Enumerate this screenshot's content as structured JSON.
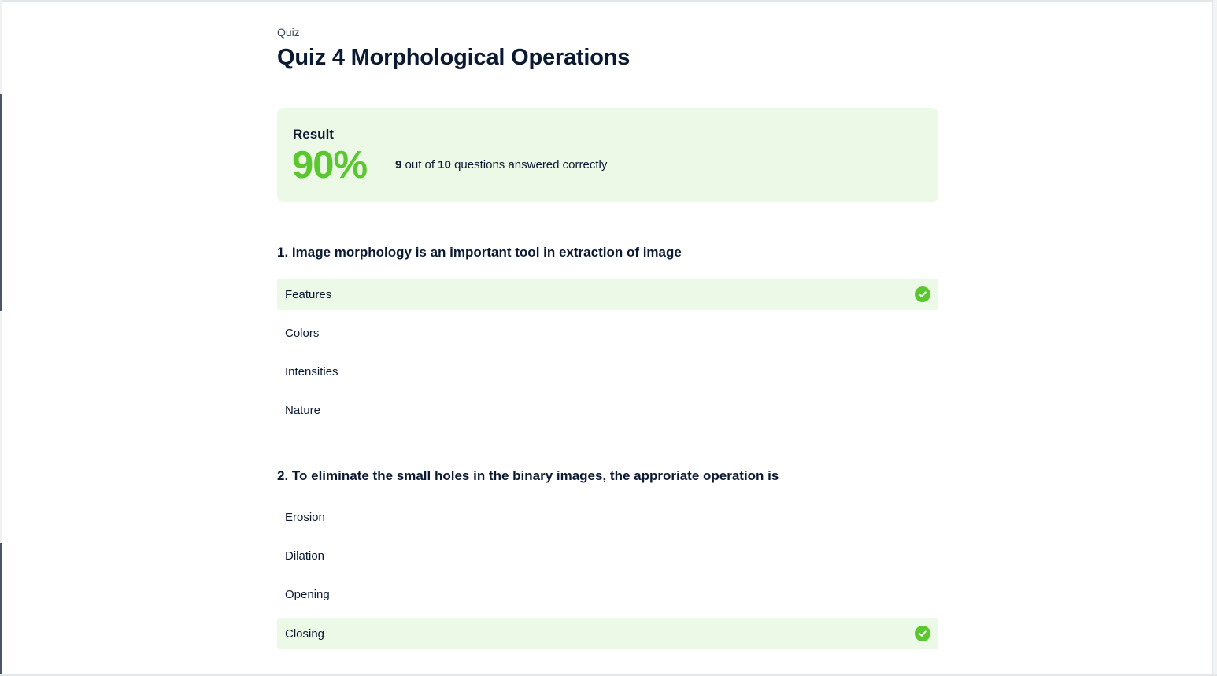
{
  "breadcrumb": "Quiz",
  "title": "Quiz 4 Morphological Operations",
  "result": {
    "label": "Result",
    "score": "90%",
    "correct_count": "9",
    "out_of_text": "out of",
    "total_count": "10",
    "suffix_text": "questions answered correctly"
  },
  "colors": {
    "accent_green": "#5ac731",
    "correct_bg": "#edf9e7",
    "text_dark": "#0b1a33"
  },
  "questions": [
    {
      "text": "1. Image morphology is an important tool in extraction of image",
      "options": [
        {
          "label": "Features",
          "correct": true,
          "icon": "check-circle-icon"
        },
        {
          "label": "Colors",
          "correct": false
        },
        {
          "label": "Intensities",
          "correct": false
        },
        {
          "label": "Nature",
          "correct": false
        }
      ]
    },
    {
      "text": "2. To eliminate the small holes in the binary images, the approriate operation is",
      "options": [
        {
          "label": "Erosion",
          "correct": false
        },
        {
          "label": "Dilation",
          "correct": false
        },
        {
          "label": "Opening",
          "correct": false
        },
        {
          "label": "Closing",
          "correct": true,
          "icon": "check-circle-icon"
        }
      ]
    }
  ]
}
